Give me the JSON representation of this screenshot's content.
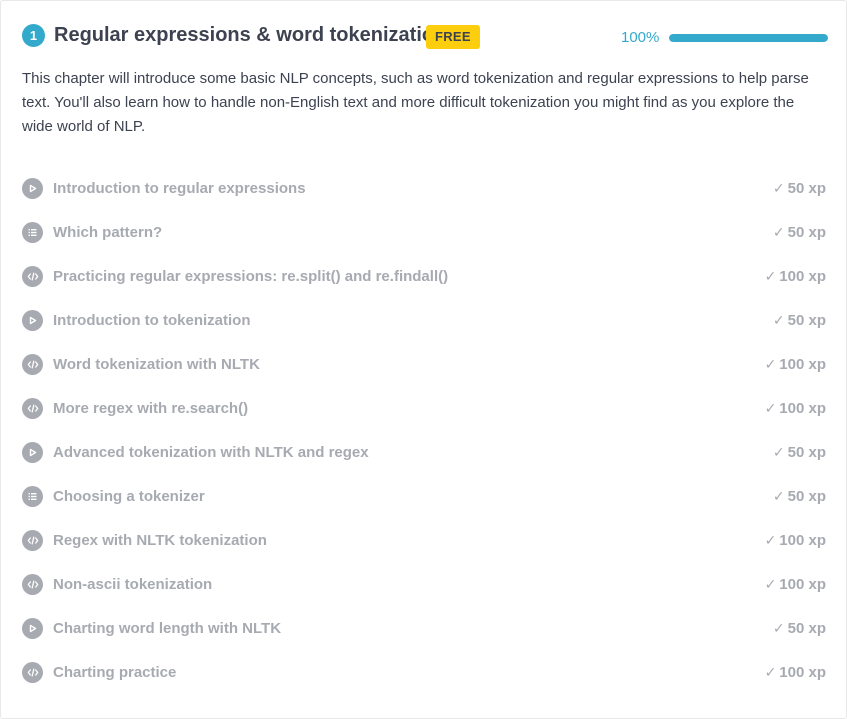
{
  "chapter": {
    "number": "1",
    "title": "Regular expressions & word tokenization",
    "badge": "FREE",
    "progress_text": "100%",
    "progress_fraction": 1.0,
    "description": "This chapter will introduce some basic NLP concepts, such as word tokenization and regular expressions to help parse text. You'll also learn how to handle non-English text and more difficult tokenization you might find as you explore the wide world of NLP."
  },
  "colors": {
    "accent": "#33aacc",
    "badge": "#fcce0d",
    "text": "#3d4251",
    "muted": "#a7aab1"
  },
  "exercises": [
    {
      "icon": "play-icon",
      "title": "Introduction to regular expressions",
      "check": "✓",
      "xp": "50 xp"
    },
    {
      "icon": "list-icon",
      "title": "Which pattern?",
      "check": "✓",
      "xp": "50 xp"
    },
    {
      "icon": "code-icon",
      "title": "Practicing regular expressions: re.split() and re.findall()",
      "check": "✓",
      "xp": "100 xp"
    },
    {
      "icon": "play-icon",
      "title": "Introduction to tokenization",
      "check": "✓",
      "xp": "50 xp"
    },
    {
      "icon": "code-icon",
      "title": "Word tokenization with NLTK",
      "check": "✓",
      "xp": "100 xp"
    },
    {
      "icon": "code-icon",
      "title": "More regex with re.search()",
      "check": "✓",
      "xp": "100 xp"
    },
    {
      "icon": "play-icon",
      "title": "Advanced tokenization with NLTK and regex",
      "check": "✓",
      "xp": "50 xp"
    },
    {
      "icon": "list-icon",
      "title": "Choosing a tokenizer",
      "check": "✓",
      "xp": "50 xp"
    },
    {
      "icon": "code-icon",
      "title": "Regex with NLTK tokenization",
      "check": "✓",
      "xp": "100 xp"
    },
    {
      "icon": "code-icon",
      "title": "Non-ascii tokenization",
      "check": "✓",
      "xp": "100 xp"
    },
    {
      "icon": "play-icon",
      "title": "Charting word length with NLTK",
      "check": "✓",
      "xp": "50 xp"
    },
    {
      "icon": "code-icon",
      "title": "Charting practice",
      "check": "✓",
      "xp": "100 xp"
    }
  ]
}
